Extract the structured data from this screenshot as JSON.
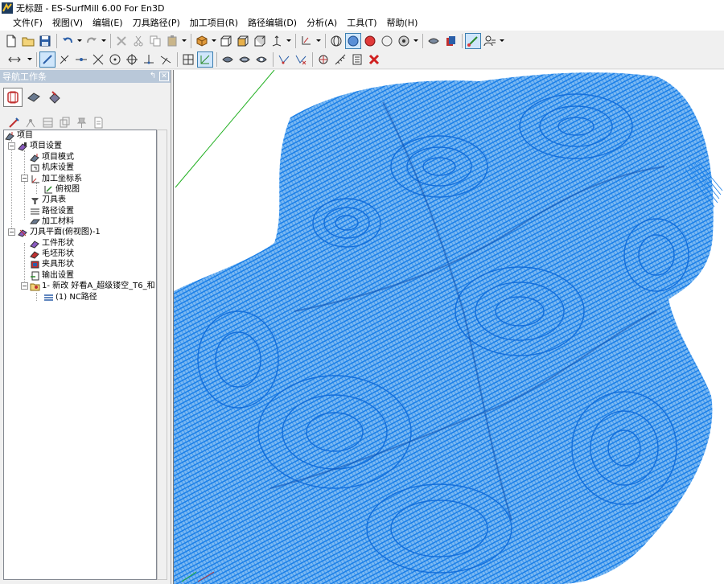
{
  "window": {
    "title": "无标题 - ES-SurfMill 6.00 For En3D"
  },
  "menu": [
    "文件(F)",
    "视图(V)",
    "编辑(E)",
    "刀具路径(P)",
    "加工项目(R)",
    "路径编辑(D)",
    "分析(A)",
    "工具(T)",
    "帮助(H)"
  ],
  "nav": {
    "title": "导航工作条",
    "tree": {
      "root": "项目",
      "project_settings": "项目设置",
      "project_mode": "项目模式",
      "machine_settings": "机床设置",
      "machining_coords": "加工坐标系",
      "top_view": "俯视图",
      "tool_table": "刀具表",
      "path_settings": "路径设置",
      "machining_material": "加工材料",
      "tool_plane": "刀具平面(俯视图)-1",
      "workpiece_shape": "工件形状",
      "blank_shape": "毛坯形状",
      "fixture_shape": "夹具形状",
      "output_settings": "输出设置",
      "job": "1- 新改 好看A_超级镂空_T6_和",
      "nc_path": "(1) NC路径"
    }
  },
  "colors": {
    "toolpath": "#1a7fe8",
    "axis": "#22b022",
    "nav_header": "#b9c8d9"
  }
}
